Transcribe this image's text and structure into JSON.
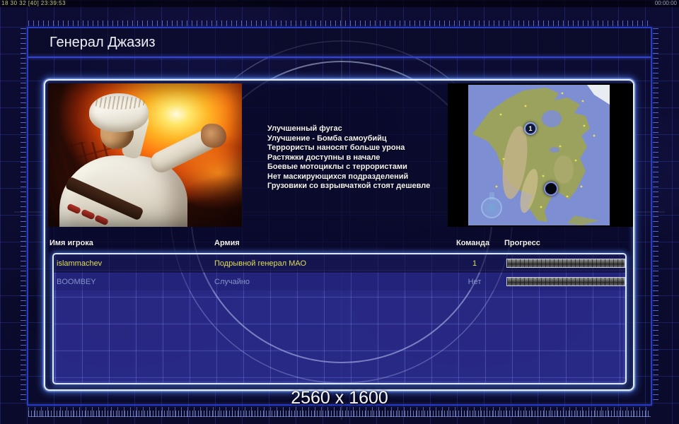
{
  "statusbar": {
    "left_stats": "18 30 32 [40] 23:39:53",
    "right_timer": "00:00:00"
  },
  "title": "Генерал Джазиз",
  "abilities": [
    "Улучшенный фугас",
    "Улучшение - Бомба самоубийц",
    "Террористы наносят больше урона",
    "Растяжки доступны в начале",
    "Боевые мотоциклы с террористами",
    "Нет маскирующихся подразделений",
    "Грузовики со взрывчаткой стоят дешевле"
  ],
  "map": {
    "marker1": "1"
  },
  "players_table": {
    "headers": [
      "Имя игрока",
      "Армия",
      "Команда",
      "Прогресс"
    ],
    "rows": [
      {
        "name": "islammachev",
        "army": "Подрывной генерал МАО",
        "team": "1"
      },
      {
        "name": "BOOMBEY",
        "army": "Случайно",
        "team": "Нет"
      }
    ]
  },
  "resolution_label": "2560 x 1600",
  "colors": {
    "frame_blue": "#2a3cc0",
    "glow_border": "#e6efff",
    "ready_text": "#dede5a",
    "waiting_text": "#8492c8",
    "map_ocean": "#7e8ed2",
    "map_land": "#9aa25e"
  }
}
